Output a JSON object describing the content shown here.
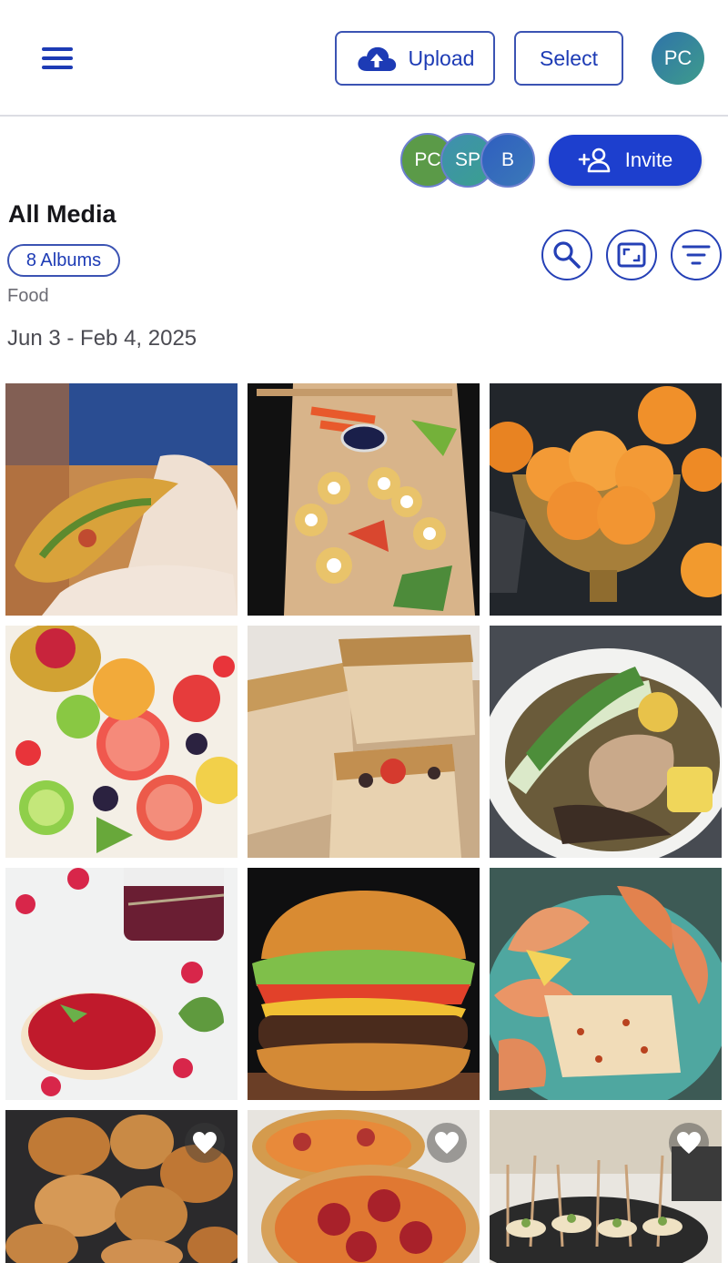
{
  "topbar": {
    "upload_label": "Upload",
    "select_label": "Select",
    "user_initials": "PC",
    "menu_icon": "hamburger-menu-icon",
    "upload_icon": "cloud-upload-icon"
  },
  "collaborators": [
    {
      "initials": "PC",
      "color": "#5b9a48"
    },
    {
      "initials": "SP",
      "color": "#3f8fb0"
    },
    {
      "initials": "B",
      "color": "#2f5ec0"
    }
  ],
  "invite": {
    "label": "Invite",
    "icon": "add-person-icon",
    "color": "#1d3fce"
  },
  "page": {
    "title": "All Media",
    "albums_label": "8 Albums",
    "sub_label": "Food",
    "date_range": "Jun 3 - Feb 4, 2025"
  },
  "toolbar_icons": [
    "search-icon",
    "aspect-frame-icon",
    "filter-icon"
  ],
  "accent": "#1d3bb5",
  "media": [
    {
      "name": "taco",
      "favorite": false
    },
    {
      "name": "sushi-board",
      "favorite": false
    },
    {
      "name": "mandarins",
      "favorite": false
    },
    {
      "name": "fruit-platter",
      "favorite": false
    },
    {
      "name": "focaccia",
      "favorite": false
    },
    {
      "name": "hotpot",
      "favorite": false
    },
    {
      "name": "raspberry-jam",
      "favorite": false
    },
    {
      "name": "burger",
      "favorite": false
    },
    {
      "name": "grilled-seafood",
      "favorite": false
    },
    {
      "name": "cinnamon-knots",
      "favorite": true
    },
    {
      "name": "pepperoni-pizza",
      "favorite": true
    },
    {
      "name": "canapes",
      "favorite": true
    }
  ]
}
